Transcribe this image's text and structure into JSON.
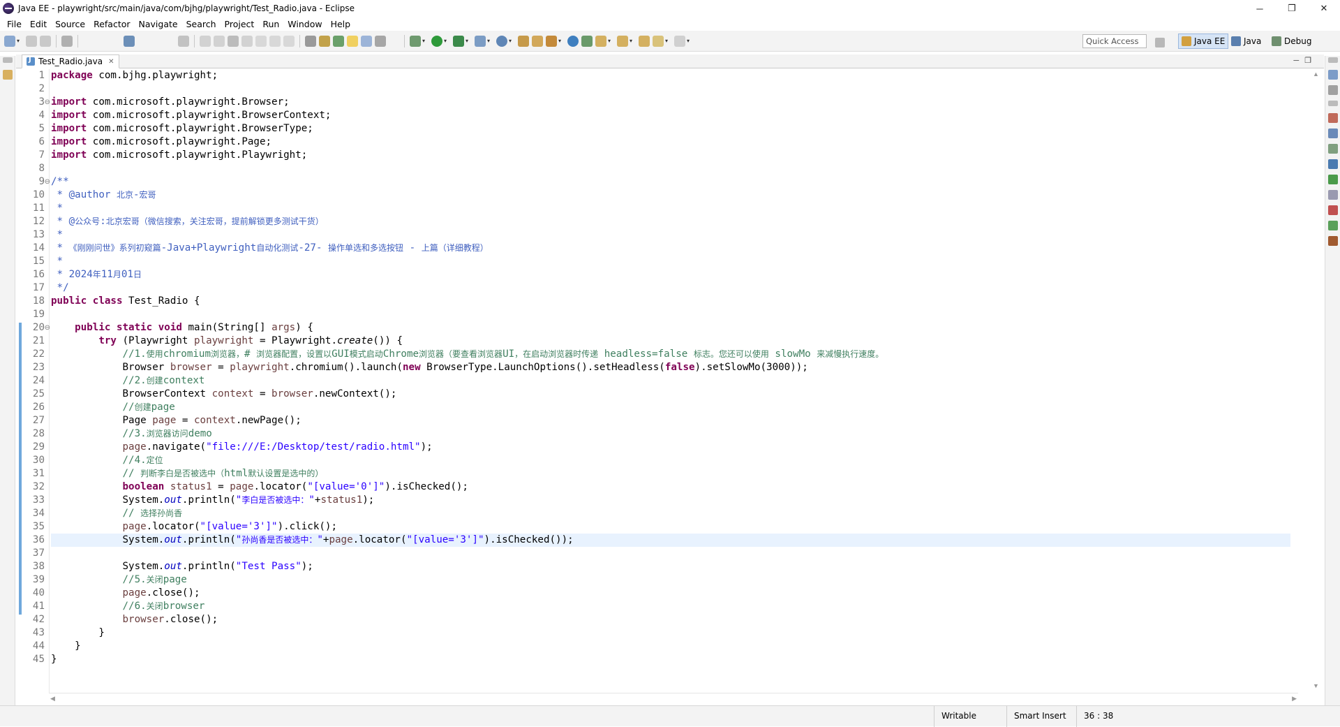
{
  "window": {
    "title": "Java EE - playwright/src/main/java/com/bjhg/playwright/Test_Radio.java - Eclipse",
    "controls": {
      "minimize": "─",
      "restore": "❐",
      "close": "✕"
    }
  },
  "menu": [
    "File",
    "Edit",
    "Source",
    "Refactor",
    "Navigate",
    "Search",
    "Project",
    "Run",
    "Window",
    "Help"
  ],
  "toolbar": {
    "quick_access_placeholder": "Quick Access",
    "perspectives": [
      {
        "label": "Java EE",
        "active": true
      },
      {
        "label": "Java",
        "active": false
      },
      {
        "label": "Debug",
        "active": false
      }
    ]
  },
  "editor": {
    "tab_title": "Test_Radio.java",
    "tab_close": "✕",
    "cursor_line": 36,
    "lines": [
      "package com.bjhg.playwright;",
      "",
      "import com.microsoft.playwright.Browser;",
      "import com.microsoft.playwright.BrowserContext;",
      "import com.microsoft.playwright.BrowserType;",
      "import com.microsoft.playwright.Page;",
      "import com.microsoft.playwright.Playwright;",
      "",
      "/**",
      " * @author 北京-宏哥",
      " *",
      " * @公众号:北京宏哥（微信搜索，关注宏哥，提前解锁更多测试干货）",
      " *",
      " * 《刚刚问世》系列初窥篇-Java+Playwright自动化测试-27- 操作单选和多选按钮 - 上篇（详细教程）",
      " *",
      " * 2024年11月01日",
      " */",
      "public class Test_Radio {",
      "",
      "    public static void main(String[] args) {",
      "        try (Playwright playwright = Playwright.create()) {",
      "            //1.使用chromium浏览器，# 浏览器配置，设置以GUI模式启动Chrome浏览器（要查看浏览器UI，在启动浏览器时传递 headless=false 标志。您还可以使用 slowMo 来减慢执行速度。",
      "            Browser browser = playwright.chromium().launch(new BrowserType.LaunchOptions().setHeadless(false).setSlowMo(3000));",
      "            //2.创建context",
      "            BrowserContext context = browser.newContext();",
      "            //创建page",
      "            Page page = context.newPage();",
      "            //3.浏览器访问demo",
      "            page.navigate(\"file:///E:/Desktop/test/radio.html\");",
      "            //4.定位",
      "            // 判断李白是否被选中（html默认设置是选中的）",
      "            boolean status1 = page.locator(\"[value='0']\").isChecked();",
      "            System.out.println(\"李白是否被选中：\"+status1);",
      "            // 选择孙尚香",
      "            page.locator(\"[value='3']\").click();",
      "            System.out.println(\"孙尚香是否被选中：\"+page.locator(\"[value='3']\").isChecked());",
      "",
      "            System.out.println(\"Test Pass\");",
      "            //5.关闭page",
      "            page.close();",
      "            //6.关闭browser",
      "            browser.close();",
      "        }",
      "    }",
      "}"
    ]
  },
  "status": {
    "writable": "Writable",
    "insert_mode": "Smart Insert",
    "position": "36 : 38"
  },
  "colors": {
    "keyword": "#7f0055",
    "comment": "#3f7f5f",
    "javadoc": "#3f5fbf",
    "string": "#2a00ff",
    "static_field": "#0000c0",
    "local_var": "#6a3e3e",
    "current_line": "#e8f2fe",
    "change_bar": "#6fa8dc"
  }
}
